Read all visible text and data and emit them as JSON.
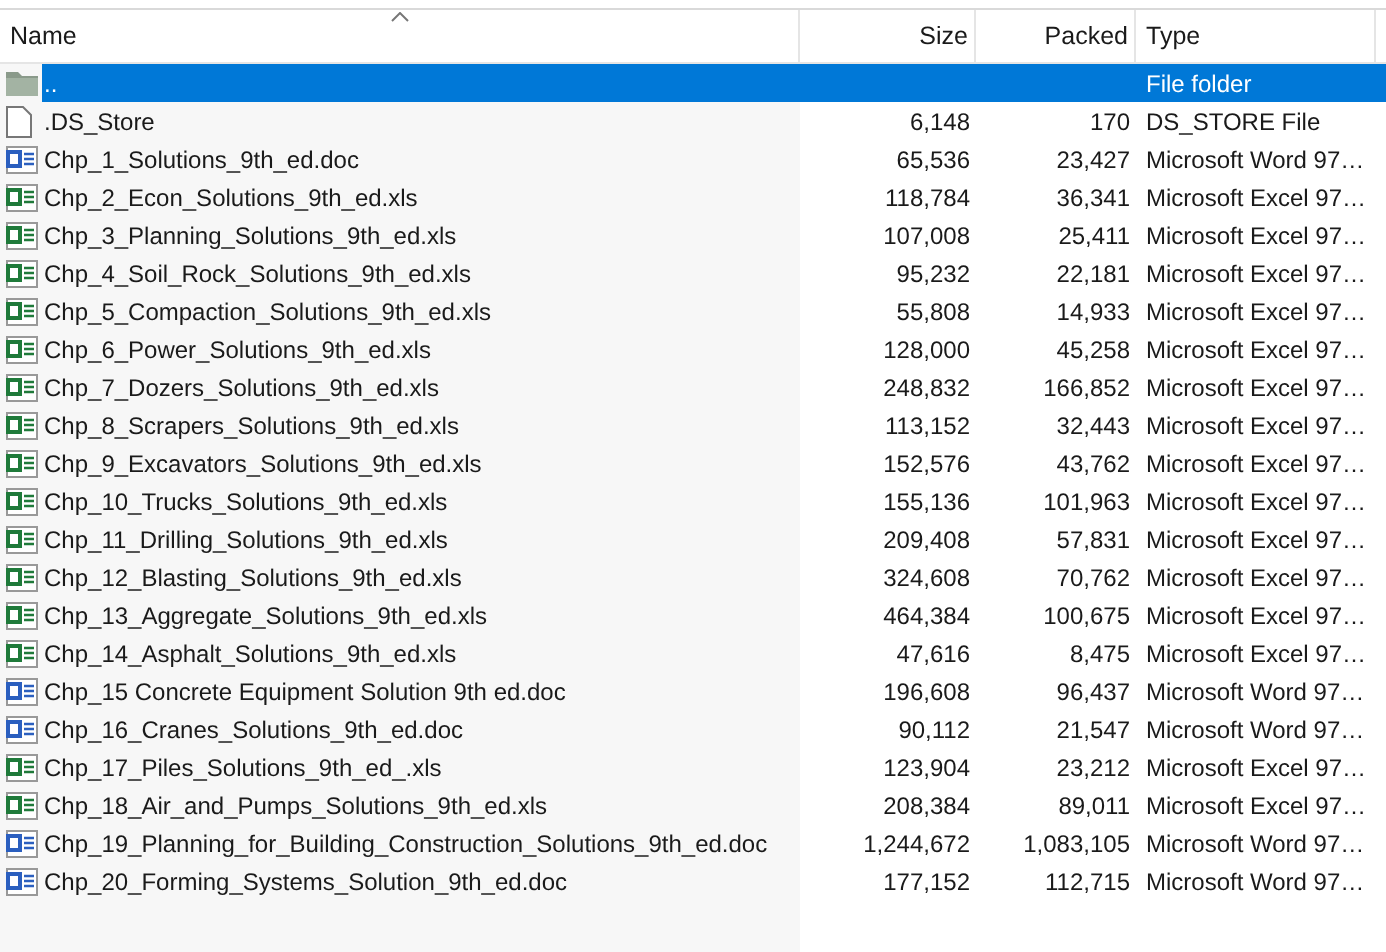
{
  "columns": [
    {
      "label": "Name",
      "sorted": true
    },
    {
      "label": "Size",
      "sorted": false
    },
    {
      "label": "Packed",
      "sorted": false
    },
    {
      "label": "Type",
      "sorted": false
    }
  ],
  "rows": [
    {
      "kind": "folder",
      "name": "..",
      "size": "",
      "packed": "",
      "type": "File folder",
      "selected": true
    },
    {
      "kind": "file",
      "name": ".DS_Store",
      "size": "6,148",
      "packed": "170",
      "type": "DS_STORE File",
      "selected": false
    },
    {
      "kind": "word",
      "name": "Chp_1_Solutions_9th_ed.doc",
      "size": "65,536",
      "packed": "23,427",
      "type": "Microsoft Word 97…",
      "selected": false
    },
    {
      "kind": "excel",
      "name": "Chp_2_Econ_Solutions_9th_ed.xls",
      "size": "118,784",
      "packed": "36,341",
      "type": "Microsoft Excel 97…",
      "selected": false
    },
    {
      "kind": "excel",
      "name": "Chp_3_Planning_Solutions_9th_ed.xls",
      "size": "107,008",
      "packed": "25,411",
      "type": "Microsoft Excel 97…",
      "selected": false
    },
    {
      "kind": "excel",
      "name": "Chp_4_Soil_Rock_Solutions_9th_ed.xls",
      "size": "95,232",
      "packed": "22,181",
      "type": "Microsoft Excel 97…",
      "selected": false
    },
    {
      "kind": "excel",
      "name": "Chp_5_Compaction_Solutions_9th_ed.xls",
      "size": "55,808",
      "packed": "14,933",
      "type": "Microsoft Excel 97…",
      "selected": false
    },
    {
      "kind": "excel",
      "name": "Chp_6_Power_Solutions_9th_ed.xls",
      "size": "128,000",
      "packed": "45,258",
      "type": "Microsoft Excel 97…",
      "selected": false
    },
    {
      "kind": "excel",
      "name": "Chp_7_Dozers_Solutions_9th_ed.xls",
      "size": "248,832",
      "packed": "166,852",
      "type": "Microsoft Excel 97…",
      "selected": false
    },
    {
      "kind": "excel",
      "name": "Chp_8_Scrapers_Solutions_9th_ed.xls",
      "size": "113,152",
      "packed": "32,443",
      "type": "Microsoft Excel 97…",
      "selected": false
    },
    {
      "kind": "excel",
      "name": "Chp_9_Excavators_Solutions_9th_ed.xls",
      "size": "152,576",
      "packed": "43,762",
      "type": "Microsoft Excel 97…",
      "selected": false
    },
    {
      "kind": "excel",
      "name": "Chp_10_Trucks_Solutions_9th_ed.xls",
      "size": "155,136",
      "packed": "101,963",
      "type": "Microsoft Excel 97…",
      "selected": false
    },
    {
      "kind": "excel",
      "name": "Chp_11_Drilling_Solutions_9th_ed.xls",
      "size": "209,408",
      "packed": "57,831",
      "type": "Microsoft Excel 97…",
      "selected": false
    },
    {
      "kind": "excel",
      "name": "Chp_12_Blasting_Solutions_9th_ed.xls",
      "size": "324,608",
      "packed": "70,762",
      "type": "Microsoft Excel 97…",
      "selected": false
    },
    {
      "kind": "excel",
      "name": "Chp_13_Aggregate_Solutions_9th_ed.xls",
      "size": "464,384",
      "packed": "100,675",
      "type": "Microsoft Excel 97…",
      "selected": false
    },
    {
      "kind": "excel",
      "name": "Chp_14_Asphalt_Solutions_9th_ed.xls",
      "size": "47,616",
      "packed": "8,475",
      "type": "Microsoft Excel 97…",
      "selected": false
    },
    {
      "kind": "word",
      "name": "Chp_15 Concrete Equipment Solution 9th ed.doc",
      "size": "196,608",
      "packed": "96,437",
      "type": "Microsoft Word 97…",
      "selected": false
    },
    {
      "kind": "word",
      "name": "Chp_16_Cranes_Solutions_9th_ed.doc",
      "size": "90,112",
      "packed": "21,547",
      "type": "Microsoft Word 97…",
      "selected": false
    },
    {
      "kind": "excel",
      "name": "Chp_17_Piles_Solutions_9th_ed_.xls",
      "size": "123,904",
      "packed": "23,212",
      "type": "Microsoft Excel 97…",
      "selected": false
    },
    {
      "kind": "excel",
      "name": "Chp_18_Air_and_Pumps_Solutions_9th_ed.xls",
      "size": "208,384",
      "packed": "89,011",
      "type": "Microsoft Excel 97…",
      "selected": false
    },
    {
      "kind": "word",
      "name": "Chp_19_Planning_for_Building_Construction_Solutions_9th_ed.doc",
      "size": "1,244,672",
      "packed": "1,083,105",
      "type": "Microsoft Word 97…",
      "selected": false
    },
    {
      "kind": "word",
      "name": "Chp_20_Forming_Systems_Solution_9th_ed.doc",
      "size": "177,152",
      "packed": "112,715",
      "type": "Microsoft Word 97…",
      "selected": false
    }
  ]
}
